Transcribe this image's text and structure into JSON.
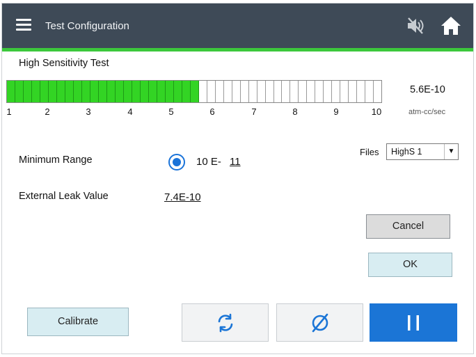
{
  "header": {
    "title": "Test Configuration",
    "menu_icon": "hamburger-menu-icon",
    "mute_icon": "speaker-muted-icon",
    "home_icon": "home-icon"
  },
  "colors": {
    "header_bg": "#3e4a57",
    "accent_green": "#3cc83c",
    "bar_fill": "#33d424",
    "primary_blue": "#1b75d6",
    "pale_button": "#d8edf2"
  },
  "test": {
    "name": "High Sensitivity Test",
    "reading": "5.6E-10",
    "unit": "atm-cc/sec",
    "scale_ticks": [
      "1",
      "2",
      "3",
      "4",
      "5",
      "6",
      "7",
      "8",
      "9",
      "10"
    ],
    "bar_segments_total": 45,
    "bar_segments_filled": 23,
    "bar_level_fraction": 0.51
  },
  "settings": {
    "minimum_range_label": "Minimum Range",
    "minimum_range_prefix": "10 E-",
    "minimum_range_exponent": "11",
    "minimum_range_selected": true,
    "external_leak_label": "External Leak Value",
    "external_leak_value": "7.4E-10"
  },
  "files": {
    "label": "Files",
    "selected": "HighS 1"
  },
  "buttons": {
    "cancel": "Cancel",
    "ok": "OK",
    "calibrate": "Calibrate"
  },
  "actions": [
    {
      "icon": "refresh-icon"
    },
    {
      "icon": "null-zero-icon"
    },
    {
      "icon": "pause-icon"
    }
  ]
}
